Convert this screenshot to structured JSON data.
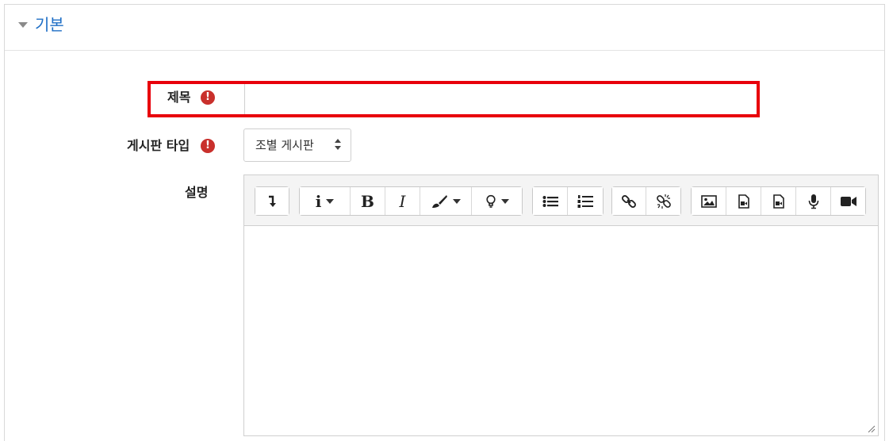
{
  "section": {
    "title": "기본"
  },
  "fields": {
    "title_label": "제목",
    "type_label": "게시판 타입",
    "description_label": "설명",
    "required_mark": "!"
  },
  "inputs": {
    "title_value": "",
    "type_selected": "조별 게시판"
  },
  "toolbar": {
    "italic_label": "I",
    "bold_label": "B",
    "info_label": "i"
  },
  "colors": {
    "accent": "#1f6fc6",
    "required": "#c9302c",
    "highlight": "#e8000b"
  }
}
